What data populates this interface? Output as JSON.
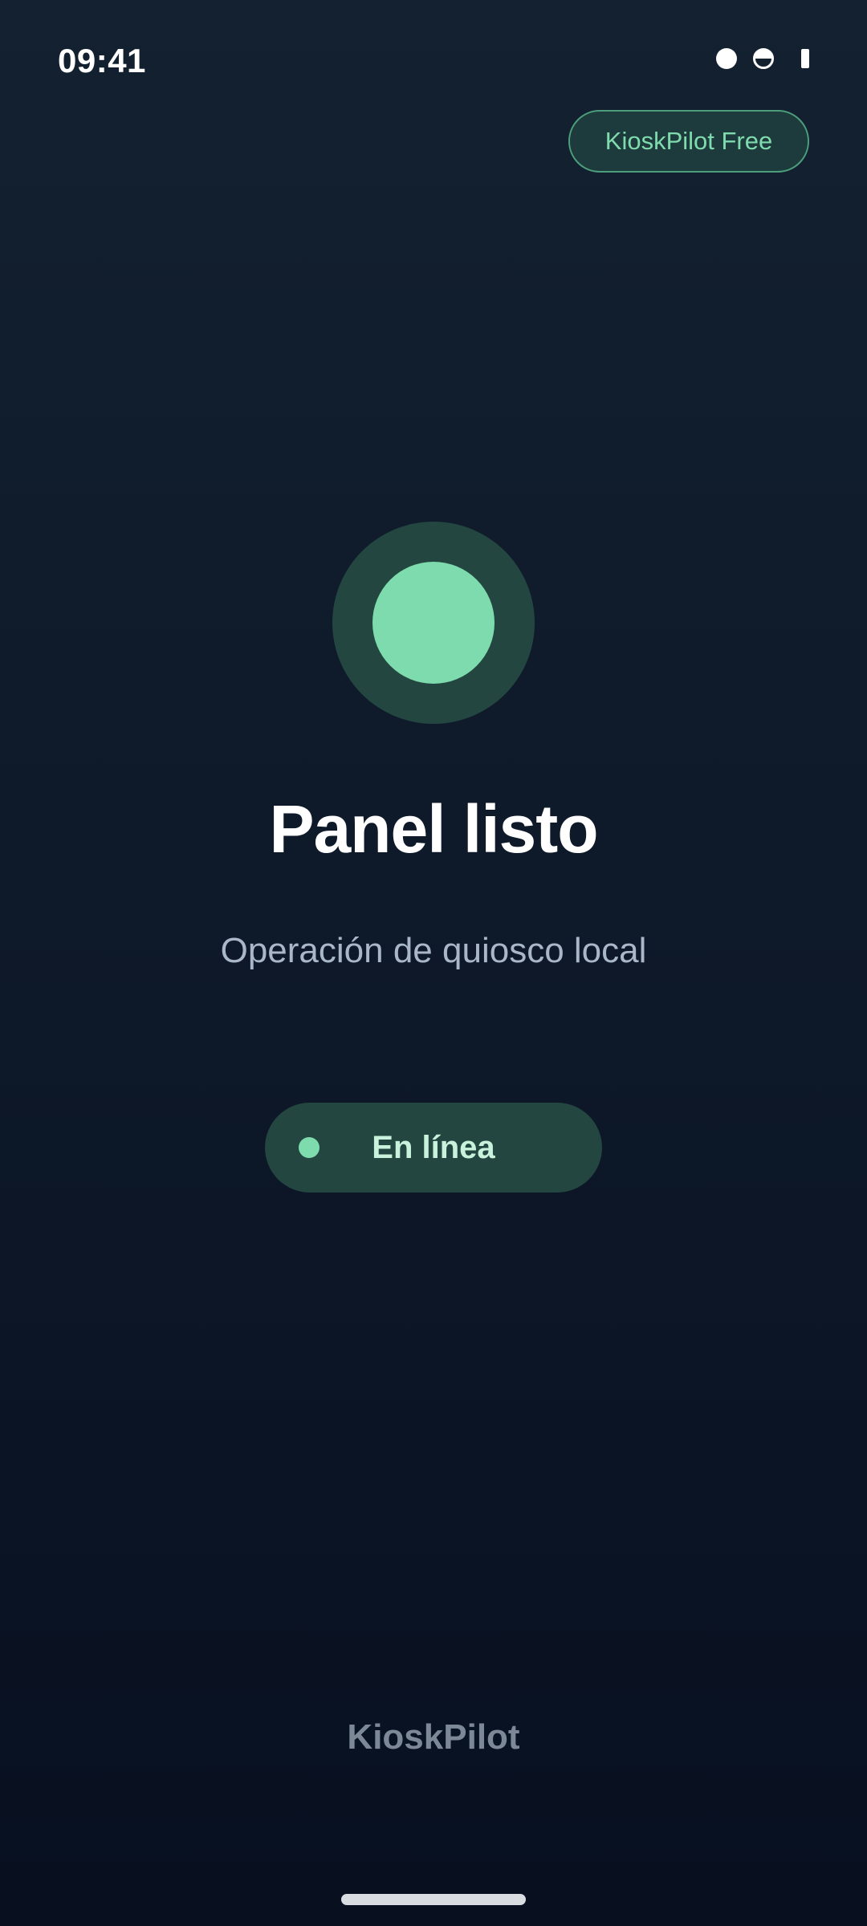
{
  "status_bar": {
    "time": "09:41",
    "icons": [
      "signal-dot-icon",
      "half-circle-icon",
      "battery-icon"
    ]
  },
  "plan_badge": {
    "label": "KioskPilot Free"
  },
  "status_indicator": {
    "icon": "status-indicator-icon",
    "ring_color": "#234640",
    "core_color": "#7ddbad"
  },
  "main": {
    "title": "Panel listo",
    "subtitle": "Operación de quiosco local"
  },
  "connection": {
    "label": "En línea",
    "dot_color": "#7ddbad"
  },
  "footer": {
    "brand": "KioskPilot"
  },
  "colors": {
    "accent": "#7ddbad",
    "background_top": "#132131",
    "background_bottom": "#081020"
  }
}
